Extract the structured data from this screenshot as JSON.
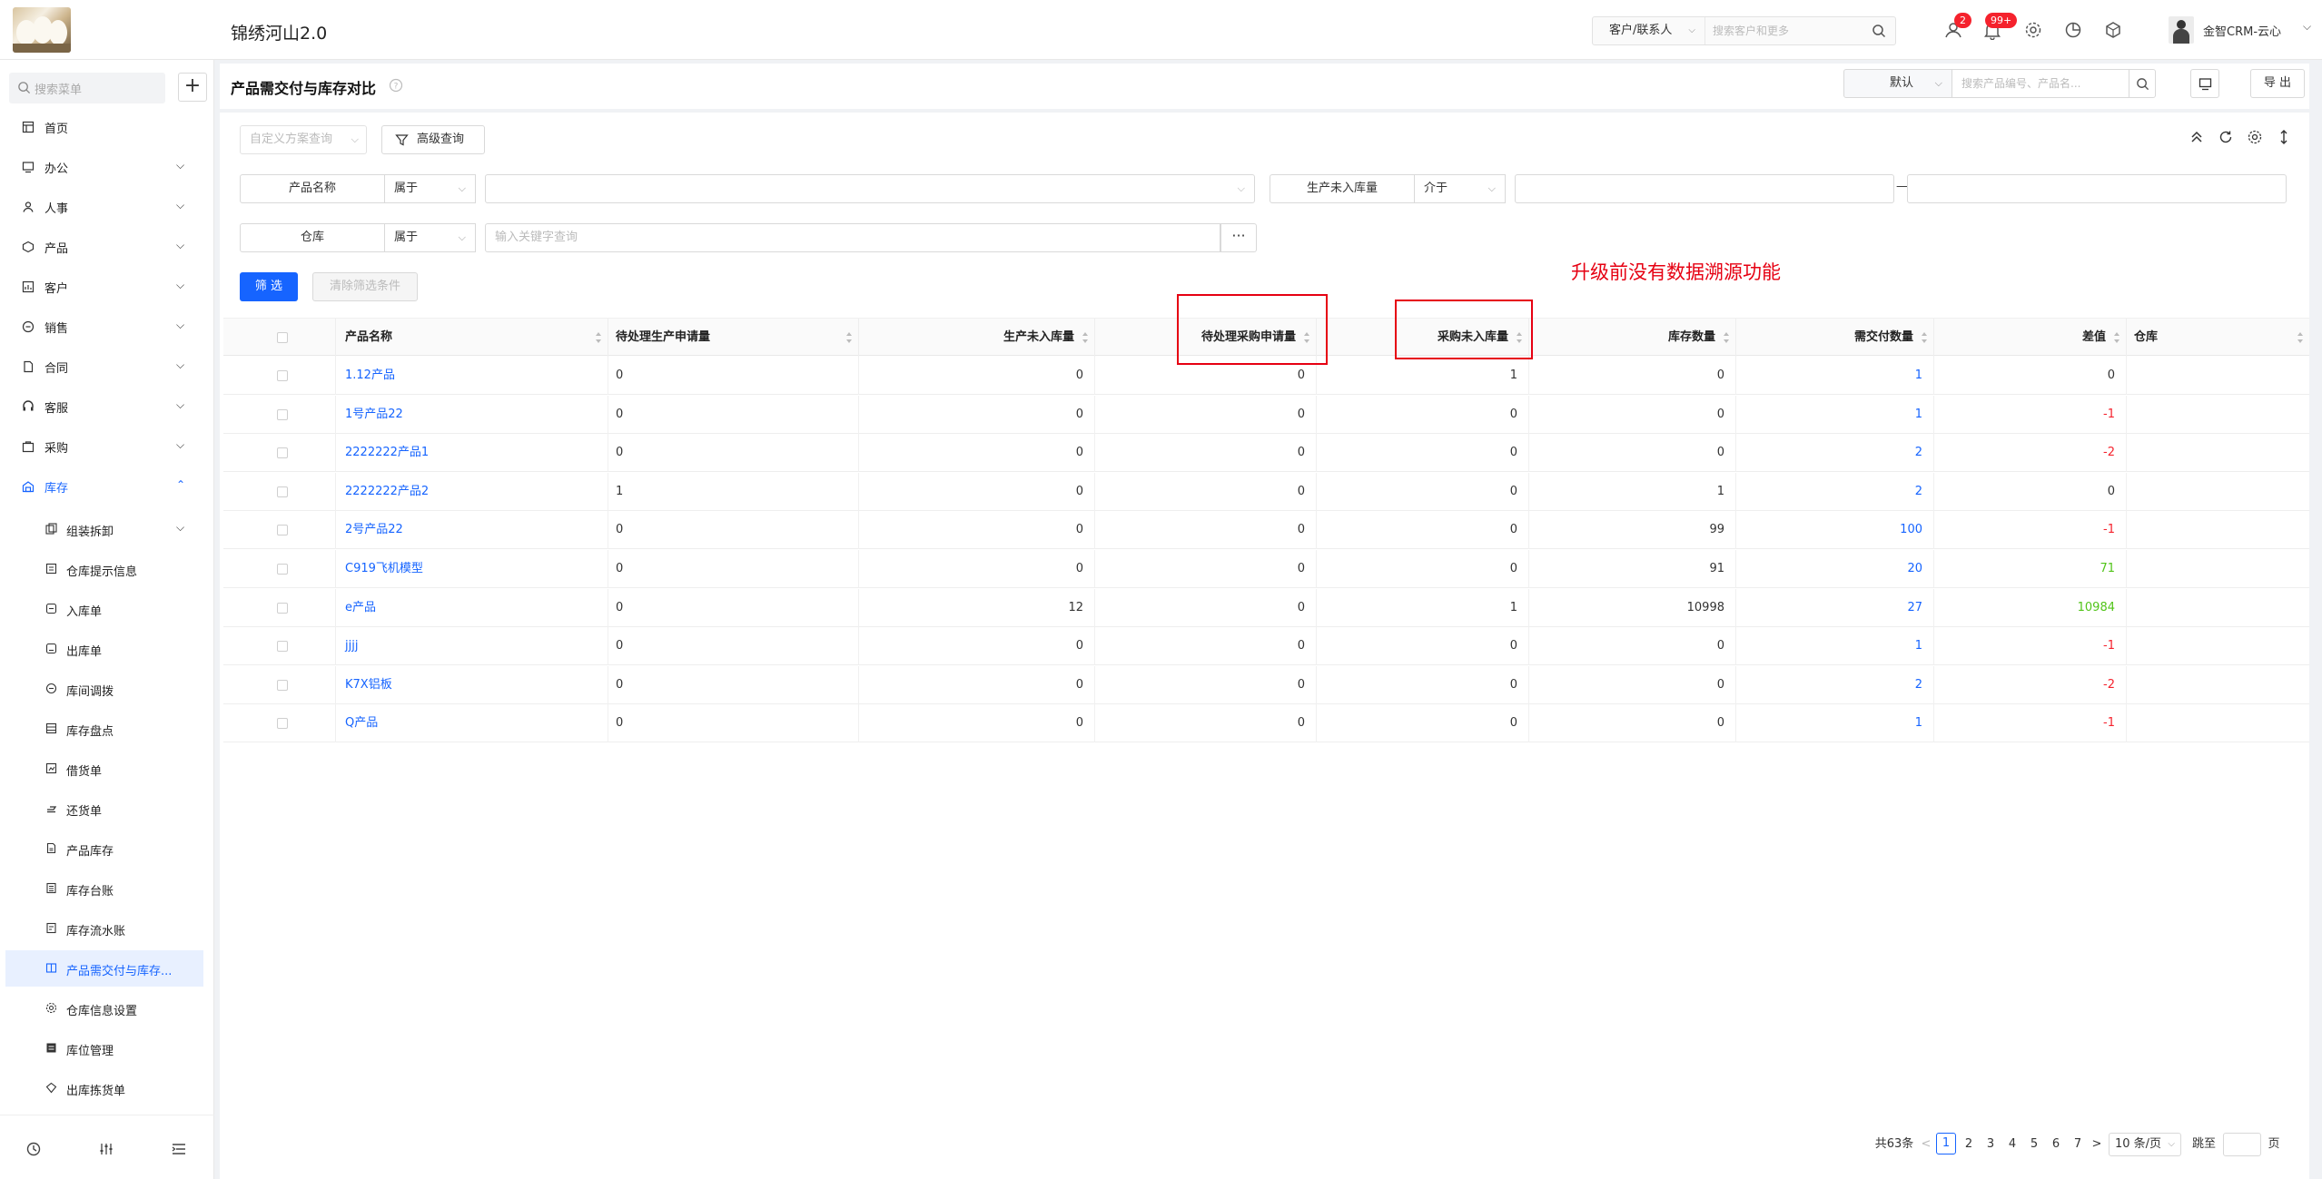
{
  "app": {
    "title": "锦绣河山2.0",
    "search_type": "客户/联系人",
    "search_placeholder": "搜索客户和更多",
    "badge_contacts": "2",
    "badge_notifications": "99+",
    "user_name": "金智CRM-云心"
  },
  "sidebar": {
    "search_placeholder": "搜索菜单",
    "items": [
      {
        "label": "首页",
        "icon": "home-icon"
      },
      {
        "label": "办公",
        "icon": "office-icon"
      },
      {
        "label": "人事",
        "icon": "people-icon"
      },
      {
        "label": "产品",
        "icon": "box-icon"
      },
      {
        "label": "客户",
        "icon": "customer-icon"
      },
      {
        "label": "销售",
        "icon": "sales-icon"
      },
      {
        "label": "合同",
        "icon": "contract-icon"
      },
      {
        "label": "客服",
        "icon": "service-icon"
      },
      {
        "label": "采购",
        "icon": "cart-icon"
      },
      {
        "label": "库存",
        "icon": "warehouse-icon"
      }
    ],
    "sub_items": [
      {
        "label": "组装拆卸",
        "icon": "assemble-icon"
      },
      {
        "label": "仓库提示信息",
        "icon": "notice-icon"
      },
      {
        "label": "入库单",
        "icon": "inbound-icon"
      },
      {
        "label": "出库单",
        "icon": "outbound-icon"
      },
      {
        "label": "库间调拨",
        "icon": "transfer-icon"
      },
      {
        "label": "库存盘点",
        "icon": "inventory-check-icon"
      },
      {
        "label": "借货单",
        "icon": "borrow-icon"
      },
      {
        "label": "还货单",
        "icon": "return-icon"
      },
      {
        "label": "产品库存",
        "icon": "product-stock-icon"
      },
      {
        "label": "库存台账",
        "icon": "ledger-icon"
      },
      {
        "label": "库存流水账",
        "icon": "journal-icon"
      },
      {
        "label": "产品需交付与库存...",
        "icon": "compare-icon"
      },
      {
        "label": "仓库信息设置",
        "icon": "settings-icon"
      },
      {
        "label": "库位管理",
        "icon": "location-icon"
      },
      {
        "label": "出库拣货单",
        "icon": "picking-icon"
      }
    ]
  },
  "header": {
    "page_title": "产品需交付与库存对比",
    "scheme": "默认",
    "search_placeholder": "搜索产品编号、产品名...",
    "export_label": "导 出"
  },
  "filters": {
    "scheme_placeholder": "自定义方案查询",
    "advanced_label": "高级查询",
    "rows": [
      {
        "field": "产品名称",
        "op": "属于",
        "value": ""
      },
      {
        "field": "生产未入库量",
        "op": "介于",
        "value": ""
      },
      {
        "field": "仓库",
        "op": "属于",
        "value": "输入关键字查询"
      }
    ],
    "range_dash": "—",
    "filter_btn": "筛 选",
    "clear_btn": "清除筛选条件"
  },
  "annotation": "升级前没有数据溯源功能",
  "table": {
    "columns": [
      "产品名称",
      "待处理生产申请量",
      "生产未入库量",
      "待处理采购申请量",
      "采购未入库量",
      "库存数量",
      "需交付数量",
      "差值",
      "仓库"
    ],
    "rows": [
      {
        "name": "1.12产品",
        "c1": "0",
        "c2": "0",
        "c3": "0",
        "c4": "1",
        "c5": "0",
        "c6": "1",
        "diff": "0",
        "diff_type": "zero",
        "wh": ""
      },
      {
        "name": "1号产品22",
        "c1": "0",
        "c2": "0",
        "c3": "0",
        "c4": "0",
        "c5": "0",
        "c6": "1",
        "diff": "-1",
        "diff_type": "neg",
        "wh": ""
      },
      {
        "name": "2222222产品1",
        "c1": "0",
        "c2": "0",
        "c3": "0",
        "c4": "0",
        "c5": "0",
        "c6": "2",
        "diff": "-2",
        "diff_type": "neg",
        "wh": ""
      },
      {
        "name": "2222222产品2",
        "c1": "1",
        "c2": "0",
        "c3": "0",
        "c4": "0",
        "c5": "1",
        "c6": "2",
        "diff": "0",
        "diff_type": "zero",
        "wh": ""
      },
      {
        "name": "2号产品22",
        "c1": "0",
        "c2": "0",
        "c3": "0",
        "c4": "0",
        "c5": "99",
        "c6": "100",
        "diff": "-1",
        "diff_type": "neg",
        "wh": ""
      },
      {
        "name": "C919飞机模型",
        "c1": "0",
        "c2": "0",
        "c3": "0",
        "c4": "0",
        "c5": "91",
        "c6": "20",
        "diff": "71",
        "diff_type": "pos",
        "wh": ""
      },
      {
        "name": "e产品",
        "c1": "0",
        "c2": "12",
        "c3": "0",
        "c4": "1",
        "c5": "10998",
        "c6": "27",
        "diff": "10984",
        "diff_type": "pos",
        "wh": ""
      },
      {
        "name": "jjjj",
        "c1": "0",
        "c2": "0",
        "c3": "0",
        "c4": "0",
        "c5": "0",
        "c6": "1",
        "diff": "-1",
        "diff_type": "neg",
        "wh": ""
      },
      {
        "name": "K7X铝板",
        "c1": "0",
        "c2": "0",
        "c3": "0",
        "c4": "0",
        "c5": "0",
        "c6": "2",
        "diff": "-2",
        "diff_type": "neg",
        "wh": ""
      },
      {
        "name": "Q产品",
        "c1": "0",
        "c2": "0",
        "c3": "0",
        "c4": "0",
        "c5": "0",
        "c6": "1",
        "diff": "-1",
        "diff_type": "neg",
        "wh": ""
      }
    ]
  },
  "pagination": {
    "total": "共63条",
    "prev": "<",
    "pages": [
      "1",
      "2",
      "3",
      "4",
      "5",
      "6",
      "7"
    ],
    "current": "1",
    "next": ">",
    "page_size": "10 条/页",
    "jump_label": "跳至",
    "page_suffix": "页"
  },
  "colors": {
    "accent": "#1664ff",
    "negative": "#f5222d",
    "positive": "#52c41a",
    "annotation": "#e60012"
  }
}
